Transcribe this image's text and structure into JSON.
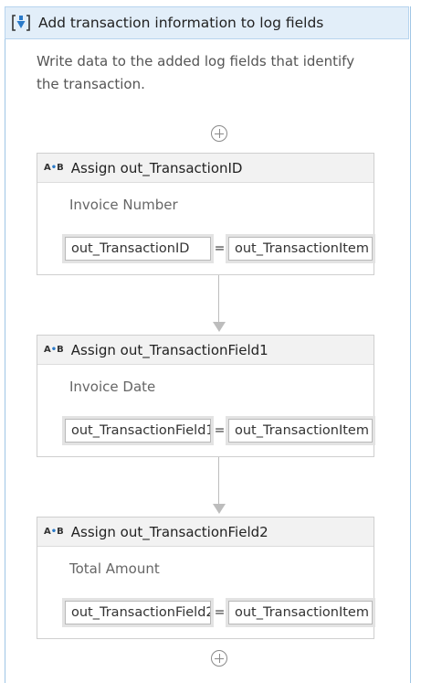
{
  "sequence": {
    "title": "Add transaction information to log fields",
    "description": "Write data to the added log fields that identify the transaction.",
    "icon": "sequence-bracket-icon",
    "accent_color": "#2a7ac9"
  },
  "activities": [
    {
      "icon_text": "A",
      "icon_mid": "•",
      "icon_text2": "B",
      "title": "Assign out_TransactionID",
      "label": "Invoice Number",
      "to_value": "out_TransactionID",
      "operator": "=",
      "value": "out_TransactionItem"
    },
    {
      "icon_text": "A",
      "icon_mid": "•",
      "icon_text2": "B",
      "title": "Assign out_TransactionField1",
      "label": "Invoice Date",
      "to_value": "out_TransactionField1",
      "operator": "=",
      "value": "out_TransactionItem"
    },
    {
      "icon_text": "A",
      "icon_mid": "•",
      "icon_text2": "B",
      "title": "Assign out_TransactionField2",
      "label": "Total Amount",
      "to_value": "out_TransactionField2",
      "operator": "=",
      "value": "out_TransactionItem"
    }
  ]
}
